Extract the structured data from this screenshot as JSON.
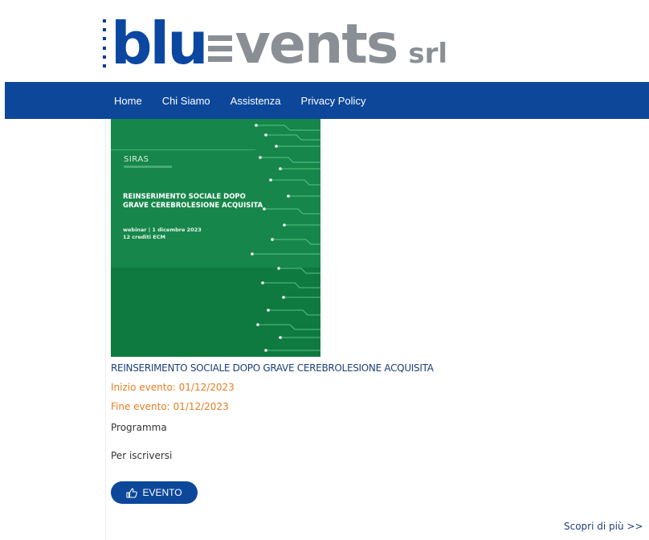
{
  "logo": {
    "brand_part1": "blu",
    "brand_part2": "vents",
    "suffix": "srl"
  },
  "nav": {
    "items": [
      {
        "label": "Home"
      },
      {
        "label": "Chi Siamo"
      },
      {
        "label": "Assistenza"
      },
      {
        "label": "Privacy Policy"
      }
    ]
  },
  "event": {
    "image": {
      "org": "SIRAS",
      "title_line1": "REINSERIMENTO SOCIALE DOPO",
      "title_line2": "GRAVE CEREBROLESIONE ACQUISITA",
      "detail_line1": "webinar | 1 dicembre 2023",
      "detail_line2": "12 crediti ECM"
    },
    "title": "REINSERIMENTO SOCIALE DOPO GRAVE CEREBROLESIONE ACQUISITA",
    "start": "Inizio evento: 01/12/2023",
    "end": "Fine evento: 01/12/2023",
    "program_label": "Programma",
    "register_label": "Per iscriversi",
    "button_label": "EVENTO",
    "button_icon": "thumbs-up-icon"
  },
  "more_link": "Scopri di più >>",
  "colors": {
    "nav_bg": "#0c479a",
    "brand_blue": "#0b47a1",
    "brand_gray": "#8a8f96",
    "date_orange": "#e67e22",
    "cover_green": "#17864a"
  }
}
